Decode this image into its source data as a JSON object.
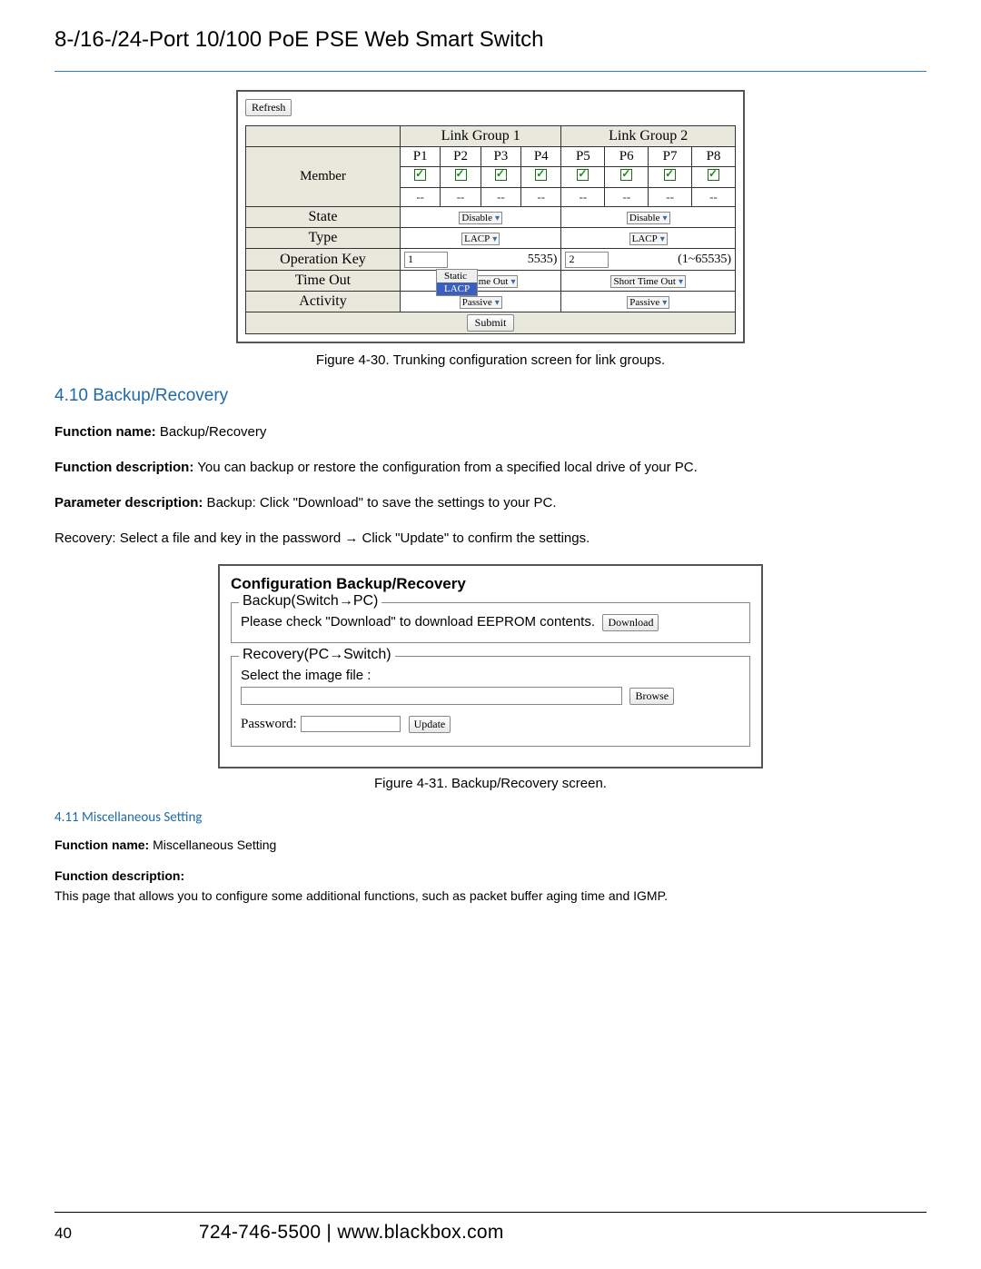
{
  "header": {
    "title": "8-/16-/24-Port 10/100 PoE PSE Web Smart Switch"
  },
  "trunking": {
    "refresh": "Refresh",
    "group1_label": "Link Group 1",
    "group2_label": "Link Group 2",
    "ports": [
      "P1",
      "P2",
      "P3",
      "P4",
      "P5",
      "P6",
      "P7",
      "P8"
    ],
    "member_label": "Member",
    "state_label": "State",
    "type_label": "Type",
    "opkey_label": "Operation Key",
    "timeout_label": "Time Out",
    "activity_label": "Activity",
    "state_value": "Disable",
    "type_value": "LACP",
    "type_options": [
      "Static",
      "LACP"
    ],
    "opkey1": "1",
    "opkey2": "2",
    "opkey_range_partial": "5535)",
    "opkey_range": "(1~65535)",
    "timeout_value": "Short Time Out",
    "activity_value": "Passive",
    "submit": "Submit",
    "caption": "Figure 4-30. Trunking configuration screen for link groups."
  },
  "section_backup": {
    "heading": "4.10 Backup/Recovery",
    "func_name_label": "Function name:",
    "func_name_value": " Backup/Recovery",
    "func_desc_label": "Function description:",
    "func_desc_value": " You can backup or restore the configuration from a specified local drive of your PC.",
    "param_desc_label": "Parameter description:",
    "param_desc_value": " Backup: Click \"Download\" to save the settings to your PC.",
    "recovery_line": "Recovery: Select a file and key in the password → Click \"Update\" to confirm the settings."
  },
  "backup_box": {
    "title": "Configuration Backup/Recovery",
    "backup_legend": "Backup(Switch→PC)",
    "backup_text": "Please check \"Download\" to download EEPROM contents.",
    "download_btn": "Download",
    "recovery_legend": "Recovery(PC→Switch)",
    "select_file_label": "Select the image file :",
    "browse_btn": "Browse",
    "password_label": "Password:",
    "update_btn": "Update",
    "caption": "Figure 4-31. Backup/Recovery screen."
  },
  "section_misc": {
    "heading": "4.11 Miscellaneous Setting",
    "func_name_label": "Function name:",
    "func_name_value": " Miscellaneous Setting",
    "func_desc_label": "Function description:",
    "func_desc_text": "This page that allows you to configure some additional functions, such as packet buffer aging time and IGMP."
  },
  "footer": {
    "page": "40",
    "contact": "724-746-5500   |   www.blackbox.com"
  }
}
